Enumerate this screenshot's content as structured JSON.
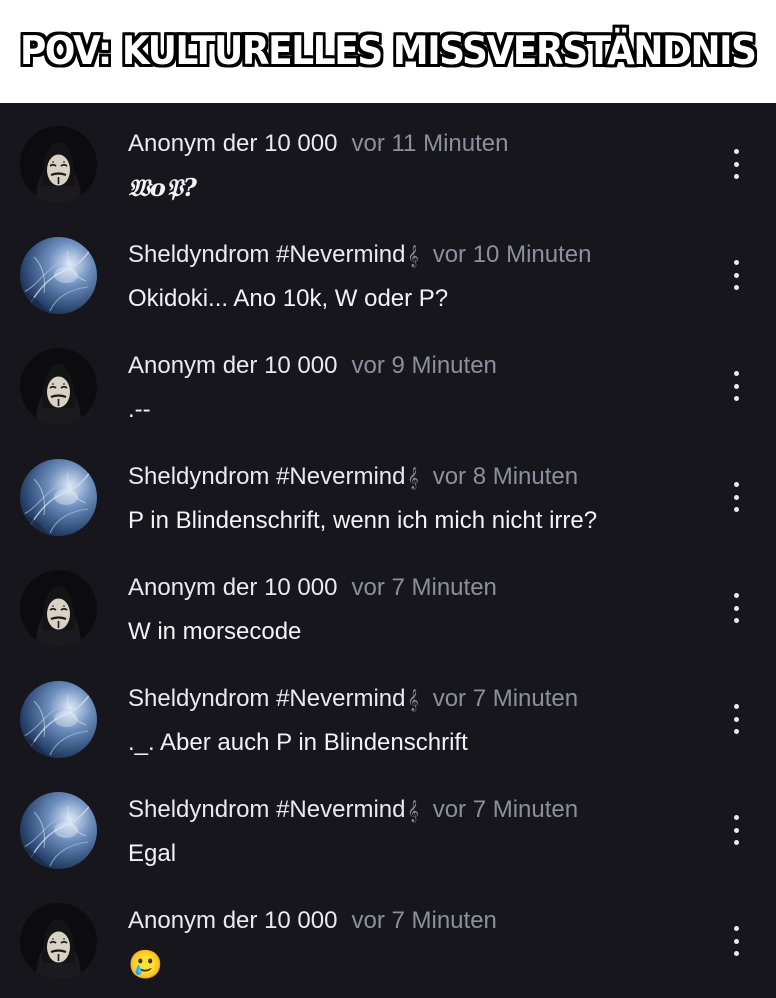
{
  "caption": "POV: KULTURELLES MISSVERSTÄNDNIS",
  "colors": {
    "background": "#16161c",
    "author": "#e9e9ee",
    "time": "#8f8f99"
  },
  "comments": [
    {
      "author": "Anonym der 10 000",
      "note": "",
      "time": "vor 11 Minuten",
      "text": "𝔚o𝔓?",
      "avatar": "anonymous-mask-avatar"
    },
    {
      "author": "Sheldyndrom #Nevermind",
      "note": "𝄞",
      "time": "vor 10 Minuten",
      "text": "Okidoki... Ano 10k, W oder P?",
      "avatar": "blue-fantasy-avatar"
    },
    {
      "author": "Anonym der 10 000",
      "note": "",
      "time": "vor 9 Minuten",
      "text": ".--",
      "avatar": "anonymous-mask-avatar"
    },
    {
      "author": "Sheldyndrom #Nevermind",
      "note": "𝄞",
      "time": "vor 8 Minuten",
      "text": "P in Blindenschrift, wenn ich mich nicht irre?",
      "avatar": "blue-fantasy-avatar"
    },
    {
      "author": "Anonym der 10 000",
      "note": "",
      "time": "vor 7 Minuten",
      "text": "W in morsecode",
      "avatar": "anonymous-mask-avatar"
    },
    {
      "author": "Sheldyndrom #Nevermind",
      "note": "𝄞",
      "time": "vor 7 Minuten",
      "text": "._. Aber auch P in Blindenschrift",
      "avatar": "blue-fantasy-avatar"
    },
    {
      "author": "Sheldyndrom #Nevermind",
      "note": "𝄞",
      "time": "vor 7 Minuten",
      "text": "Egal",
      "avatar": "blue-fantasy-avatar"
    },
    {
      "author": "Anonym der 10 000",
      "note": "",
      "time": "vor 7 Minuten",
      "text": "🥲",
      "avatar": "anonymous-mask-avatar"
    }
  ]
}
